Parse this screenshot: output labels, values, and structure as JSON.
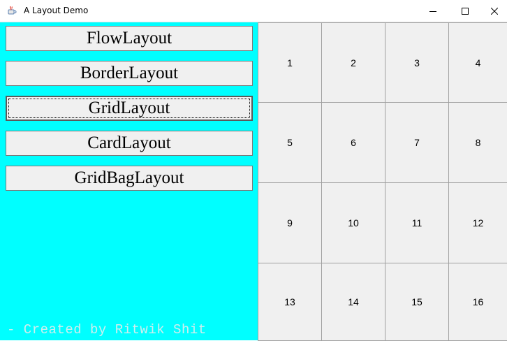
{
  "window": {
    "title": "A Layout Demo",
    "icon": "java-cup-icon",
    "controls": [
      "minimize-icon",
      "maximize-icon",
      "close-icon"
    ]
  },
  "left_panel": {
    "background": "#00ffff",
    "buttons": [
      {
        "label": "FlowLayout"
      },
      {
        "label": "BorderLayout"
      },
      {
        "label": "GridLayout",
        "focused": true
      },
      {
        "label": "CardLayout"
      },
      {
        "label": "GridBagLayout"
      }
    ],
    "credit": "- Created by Ritwik Shit"
  },
  "grid_panel": {
    "rows": 4,
    "cols": 4,
    "cells": [
      "1",
      "2",
      "3",
      "4",
      "5",
      "6",
      "7",
      "8",
      "9",
      "10",
      "11",
      "12",
      "13",
      "14",
      "15",
      "16"
    ]
  }
}
